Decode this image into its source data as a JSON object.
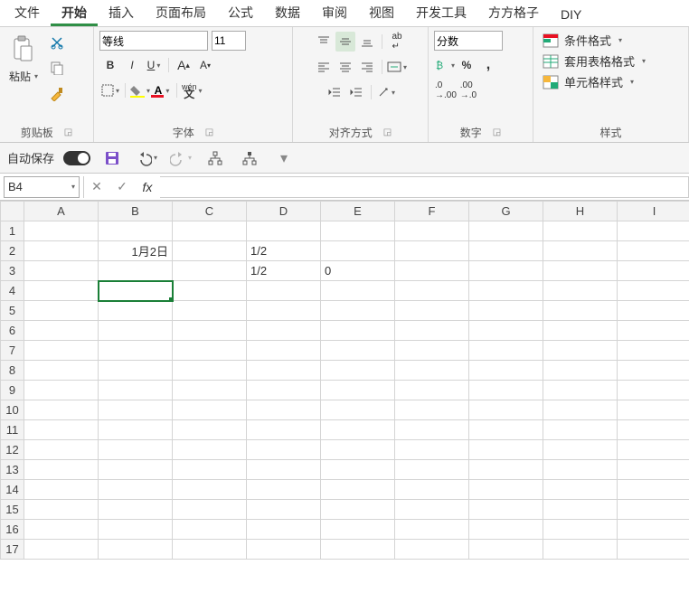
{
  "menu": {
    "items": [
      "文件",
      "开始",
      "插入",
      "页面布局",
      "公式",
      "数据",
      "审阅",
      "视图",
      "开发工具",
      "方方格子",
      "DIY"
    ],
    "active_index": 1
  },
  "ribbon": {
    "clipboard": {
      "label": "剪贴板",
      "paste": "粘贴"
    },
    "font": {
      "label": "字体",
      "name": "等线",
      "size": "11"
    },
    "align": {
      "label": "对齐方式"
    },
    "number": {
      "label": "数字",
      "format": "分数"
    },
    "styles": {
      "label": "样式",
      "conditional": "条件格式",
      "tableformat": "套用表格格式",
      "cellstyles": "单元格样式"
    }
  },
  "qat": {
    "autosave_label": "自动保存"
  },
  "formula_bar": {
    "cellref": "B4",
    "fx_label": "fx",
    "value": ""
  },
  "grid": {
    "columns": [
      "A",
      "B",
      "C",
      "D",
      "E",
      "F",
      "G",
      "H",
      "I"
    ],
    "rows": 17,
    "selected": "B4",
    "cells": {
      "B2": {
        "v": "1月2日",
        "align": "right"
      },
      "D2": {
        "v": "1/2",
        "align": "left"
      },
      "D3": {
        "v": "1/2",
        "align": "left"
      },
      "E3": {
        "v": "0",
        "align": "left"
      }
    }
  }
}
